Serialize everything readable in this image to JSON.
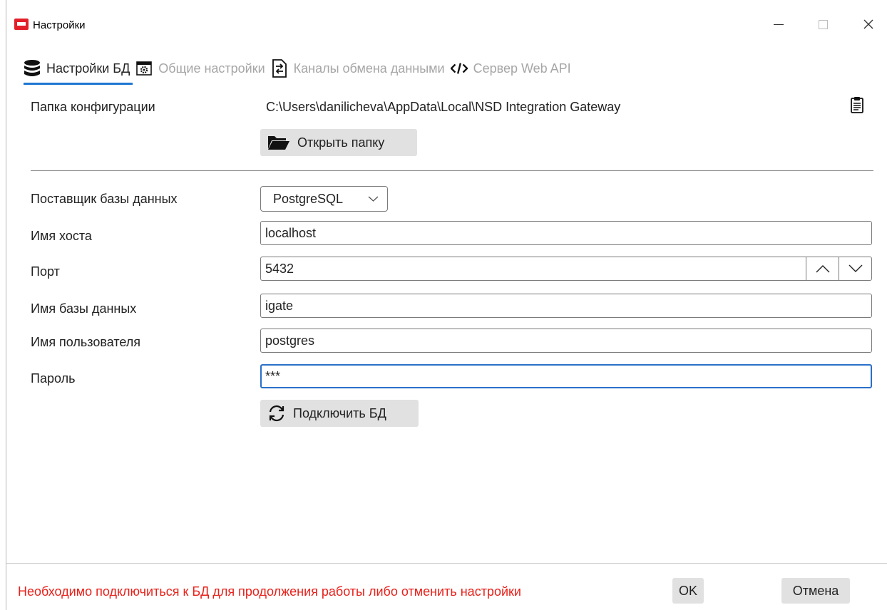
{
  "window": {
    "title": "Настройки"
  },
  "tabs": [
    {
      "label": "Настройки БД",
      "icon": "database-icon",
      "active": true
    },
    {
      "label": "Общие настройки",
      "icon": "window-gear-icon",
      "active": false
    },
    {
      "label": "Каналы обмена данными",
      "icon": "exchange-document-icon",
      "active": false
    },
    {
      "label": "Сервер Web API",
      "icon": "code-icon",
      "active": false
    }
  ],
  "config": {
    "folder_label": "Папка конфигурации",
    "folder_path": "C:\\Users\\danilicheva\\AppData\\Local\\NSD Integration Gateway",
    "open_folder_label": "Открыть папку"
  },
  "db": {
    "provider_label": "Поставщик базы данных",
    "provider_value": "PostgreSQL",
    "host_label": "Имя хоста",
    "host_value": "localhost",
    "port_label": "Порт",
    "port_value": "5432",
    "dbname_label": "Имя базы данных",
    "dbname_value": "igate",
    "user_label": "Имя пользователя",
    "user_value": "postgres",
    "password_label": "Пароль",
    "password_value": "***",
    "connect_label": "Подключить БД"
  },
  "footer": {
    "error_message": "Необходимо подключиться к БД для продолжения работы либо отменить настройки",
    "ok_label": "OK",
    "cancel_label": "Отмена"
  },
  "colors": {
    "accent": "#1e76d2",
    "error": "#e8211a",
    "app_icon": "#e3202a",
    "button_bg": "#e1e1e1"
  }
}
